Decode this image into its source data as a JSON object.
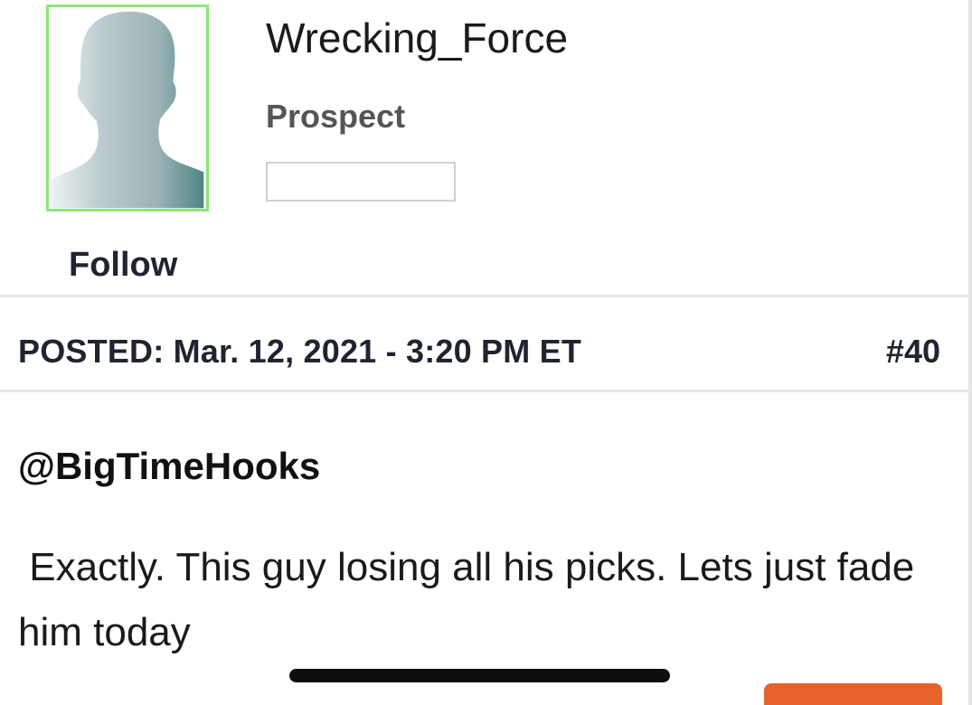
{
  "profile": {
    "username": "Wrecking_Force",
    "rank": "Prospect",
    "follow_label": "Follow",
    "avatar_border_color": "#8ee57a"
  },
  "post": {
    "posted_label": "POSTED: Mar. 12, 2021 - 3:20 PM ET",
    "number": "#40",
    "mention": "@BigTimeHooks",
    "body": " Exactly. This guy losing all his picks. Lets just fade him today"
  },
  "colors": {
    "accent_button": "#e8622c",
    "text": "#1f2430",
    "divider": "#e6e6e6"
  }
}
